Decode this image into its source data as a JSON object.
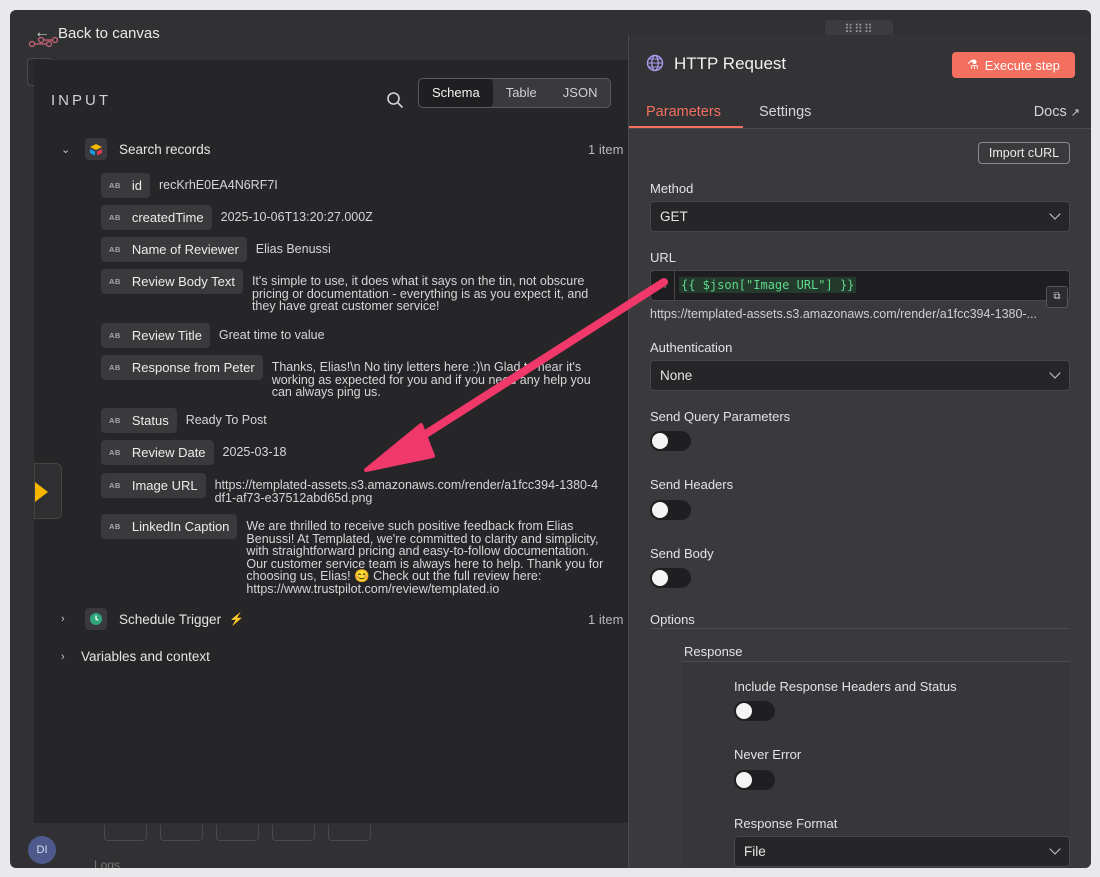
{
  "nav": {
    "back_label": "Back to canvas"
  },
  "input_panel": {
    "heading": "INPUT",
    "views": [
      "Schema",
      "Table",
      "JSON"
    ],
    "active_view": "Schema",
    "search_records": {
      "label": "Search records",
      "count": "1 item"
    },
    "fields": [
      {
        "key": "id",
        "value": "recKrhE0EA4N6RF7I"
      },
      {
        "key": "createdTime",
        "value": "2025-10-06T13:20:27.000Z"
      },
      {
        "key": "Name of Reviewer",
        "value": "Elias Benussi"
      },
      {
        "key": "Review Body Text",
        "value": "It's simple to use, it does what it says on the tin, not obscure pricing or documentation - everything is as you expect it, and they have great customer service!"
      },
      {
        "key": "Review Title",
        "value": "Great time to value"
      },
      {
        "key": "Response from Peter",
        "value": "Thanks, Elias!\\n No tiny letters here :)\\n Glad to hear it's working as expected for you and if you need any help you can always ping us."
      },
      {
        "key": "Status",
        "value": "Ready To Post"
      },
      {
        "key": "Review Date",
        "value": "2025-03-18"
      },
      {
        "key": "Image URL",
        "value": "https://templated-assets.s3.amazonaws.com/render/a1fcc394-1380-4df1-af73-e37512abd65d.png"
      },
      {
        "key": "LinkedIn Caption",
        "value": "We are thrilled to receive such positive feedback from Elias Benussi! At Templated, we're committed to clarity and simplicity, with straightforward pricing and easy-to-follow documentation. Our customer service team is always here to help. Thank you for choosing us, Elias! 😊 Check out the full review here: https://www.trustpilot.com/review/templated.io"
      }
    ],
    "schedule_trigger": {
      "label": "Schedule Trigger",
      "count": "1 item"
    },
    "variables_label": "Variables and context"
  },
  "node_panel": {
    "title": "HTTP Request",
    "execute_label": "Execute step",
    "tabs": [
      "Parameters",
      "Settings"
    ],
    "docs_label": "Docs",
    "import_label": "Import cURL",
    "method": {
      "label": "Method",
      "value": "GET"
    },
    "url": {
      "label": "URL",
      "expression": "{{ $json[\"Image URL\"] }}",
      "resolved": "https://templated-assets.s3.amazonaws.com/render/a1fcc394-1380-..."
    },
    "authentication": {
      "label": "Authentication",
      "value": "None"
    },
    "send_query": {
      "label": "Send Query Parameters",
      "on": false
    },
    "send_headers": {
      "label": "Send Headers",
      "on": false
    },
    "send_body": {
      "label": "Send Body",
      "on": false
    },
    "options": {
      "label": "Options",
      "response_label": "Response",
      "include_headers": {
        "label": "Include Response Headers and Status",
        "on": false
      },
      "never_error": {
        "label": "Never Error",
        "on": false
      },
      "response_format": {
        "label": "Response Format",
        "value": "File"
      }
    }
  },
  "footer": {
    "avatar_initials": "DI",
    "logs_label": "Logs"
  },
  "colors": {
    "accent": "#f36f5f",
    "annotation_arrow": "#f0386b",
    "expression_green": "#5fd88a"
  }
}
